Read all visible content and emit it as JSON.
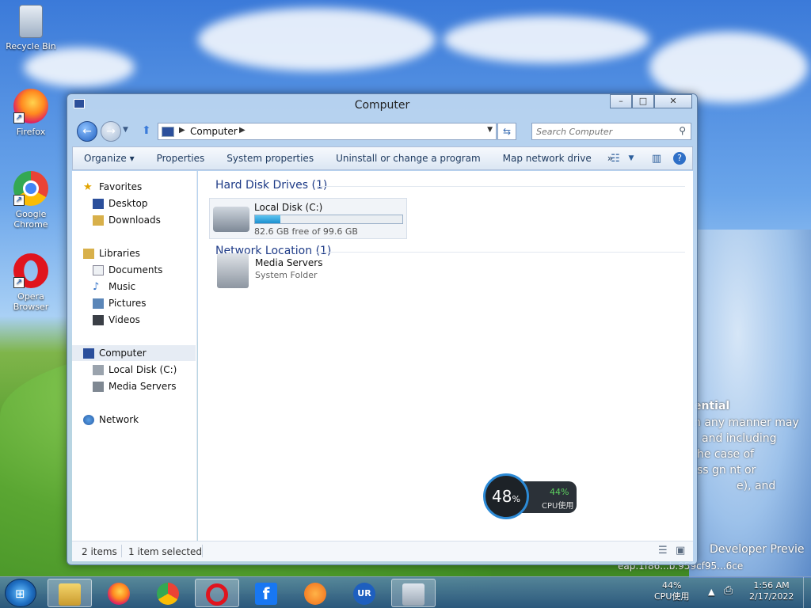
{
  "desktop": {
    "icons": [
      {
        "label": "Recycle Bin"
      },
      {
        "label": "Firefox"
      },
      {
        "label": "Google Chrome"
      },
      {
        "label": "Opera Browser"
      }
    ],
    "wallpaper_text": [
      "ential",
      "n any manner may",
      "and including",
      "he case of",
      "ss gn nt or",
      "e), and",
      "Developer Previe",
      "eap.1f86...b.959cf95...6ce"
    ]
  },
  "window": {
    "title": "Computer",
    "minimize_glyph": "–",
    "maximize_glyph": "□",
    "close_glyph": "✕"
  },
  "address_bar": {
    "path": [
      "Computer"
    ],
    "search_placeholder": "Search Computer"
  },
  "toolbar": {
    "items": [
      "Organize ▾",
      "Properties",
      "System properties",
      "Uninstall or change a program",
      "Map network drive",
      "»"
    ]
  },
  "navigation": {
    "favorites": {
      "label": "Favorites",
      "items": [
        "Desktop",
        "Downloads"
      ]
    },
    "libraries": {
      "label": "Libraries",
      "items": [
        "Documents",
        "Music",
        "Pictures",
        "Videos"
      ]
    },
    "computer": {
      "label": "Computer",
      "items": [
        "Local Disk (C:)",
        "Media Servers"
      ]
    },
    "network": {
      "label": "Network"
    }
  },
  "content": {
    "hard_disk_title": "Hard Disk Drives (1)",
    "drive": {
      "name": "Local Disk (C:)",
      "free_text": "82.6 GB free of 99.6 GB",
      "used_fraction": 0.17
    },
    "network_title": "Network Location (1)",
    "network_item": {
      "name": "Media Servers",
      "type": "System Folder"
    }
  },
  "status_bar": {
    "items_count": "2 items",
    "selected": "1 item selected"
  },
  "cpu_widget": {
    "percent": "48",
    "percent_unit": "%",
    "secondary": "44%",
    "label": "CPU使用"
  },
  "taskbar": {
    "apps": [
      "File Explorer",
      "Firefox",
      "Google Chrome",
      "Opera",
      "Facebook",
      "Brave",
      "UR Browser",
      "System Monitor"
    ],
    "tray_cpu_percent": "44%",
    "tray_cpu_label": "CPU使用",
    "time": "1:56 AM",
    "date": "2/17/2022"
  },
  "colors": {
    "accent": "#1e3b87",
    "progress": "#1b8fcf",
    "cpu_ring": "#2c8ad6",
    "cpu_green": "#5ed260"
  }
}
